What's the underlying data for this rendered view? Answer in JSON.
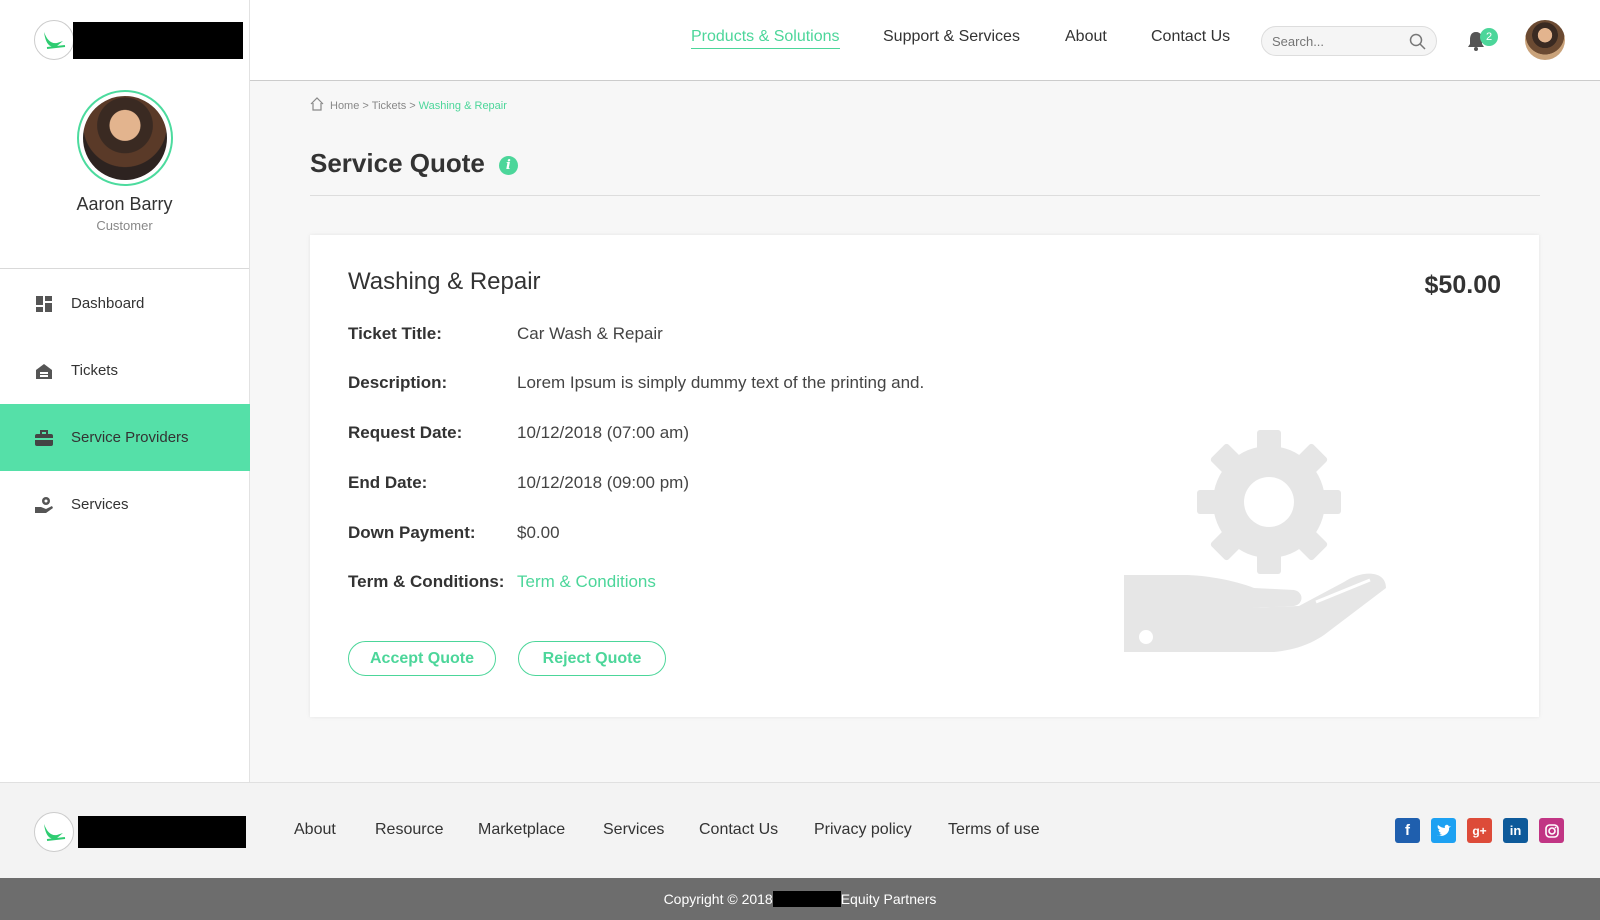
{
  "sidebar": {
    "profile": {
      "name": "Aaron Barry",
      "role": "Customer"
    },
    "items": [
      {
        "label": "Dashboard",
        "icon": "dashboard-icon"
      },
      {
        "label": "Tickets",
        "icon": "tickets-icon"
      },
      {
        "label": "Service Providers",
        "icon": "briefcase-icon",
        "active": true
      },
      {
        "label": "Services",
        "icon": "services-icon"
      }
    ]
  },
  "header": {
    "nav": [
      "Products & Solutions",
      "Support & Services",
      "About",
      "Contact Us"
    ],
    "active_nav": "Products & Solutions",
    "search_placeholder": "Search...",
    "notification_count": "2"
  },
  "breadcrumb": {
    "home": "Home",
    "tickets": "Tickets",
    "current": "Washing & Repair"
  },
  "page_title": "Service Quote",
  "quote": {
    "title": "Washing & Repair",
    "price": "$50.00",
    "fields": [
      {
        "label": "Ticket Title:",
        "value": "Car Wash & Repair"
      },
      {
        "label": "Description:",
        "value": "Lorem Ipsum is simply dummy text of the printing and."
      },
      {
        "label": "Request Date:",
        "value": "10/12/2018 (07:00 am)"
      },
      {
        "label": "End Date:",
        "value": "10/12/2018 (09:00 pm)"
      },
      {
        "label": "Down Payment:",
        "value": "$0.00"
      },
      {
        "label": "Term & Conditions:",
        "value": "Term & Conditions"
      }
    ],
    "accept_label": "Accept Quote",
    "reject_label": "Reject Quote"
  },
  "footer": {
    "links": [
      "About",
      "Resource",
      "Marketplace",
      "Services",
      "Contact Us",
      "Privacy policy",
      "Terms of use"
    ],
    "social": [
      "facebook-icon",
      "twitter-icon",
      "google-plus-icon",
      "linkedin-icon",
      "instagram-icon"
    ],
    "copyright_prefix": "Copyright © 2018",
    "copyright_suffix": "Equity Partners"
  },
  "colors": {
    "accent": "#4cd69a",
    "active_nav_bg": "#55e0a8",
    "footer_bar": "#6d6d6d"
  }
}
